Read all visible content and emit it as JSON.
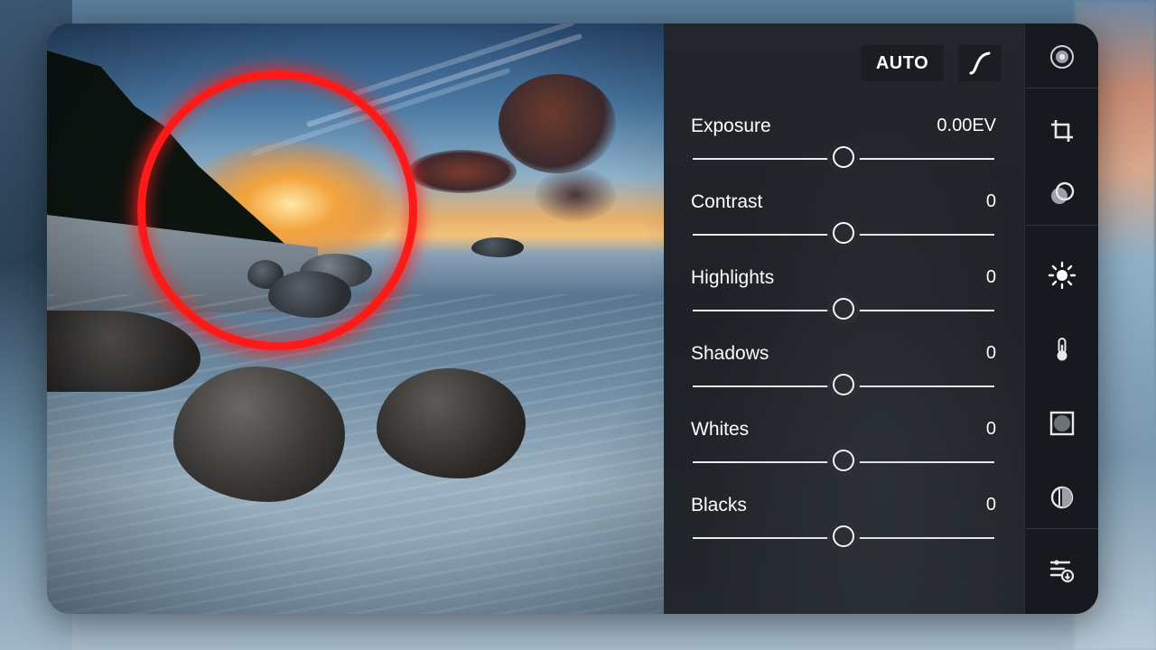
{
  "panel": {
    "auto_label": "AUTO",
    "adjustments": [
      {
        "label": "Exposure",
        "value": "0.00EV",
        "level": 0.5
      },
      {
        "label": "Contrast",
        "value": "0",
        "level": 0.5
      },
      {
        "label": "Highlights",
        "value": "0",
        "level": 0.5
      },
      {
        "label": "Shadows",
        "value": "0",
        "level": 0.5
      },
      {
        "label": "Whites",
        "value": "0",
        "level": 0.5
      },
      {
        "label": "Blacks",
        "value": "0",
        "level": 0.5
      }
    ]
  },
  "toolbar": {
    "tools": [
      {
        "icon": "presets-icon"
      },
      {
        "icon": "crop-icon"
      },
      {
        "icon": "selective-icon"
      },
      {
        "icon": "light-icon",
        "active": true
      },
      {
        "icon": "color-temperature-icon"
      },
      {
        "icon": "vignette-icon"
      },
      {
        "icon": "optics-icon"
      },
      {
        "icon": "more-adjustments-icon"
      }
    ]
  },
  "colors": {
    "highlight_ring": "#ff1a1a",
    "panel_bg": "#23272c",
    "toolstrip_bg": "#16191d"
  }
}
